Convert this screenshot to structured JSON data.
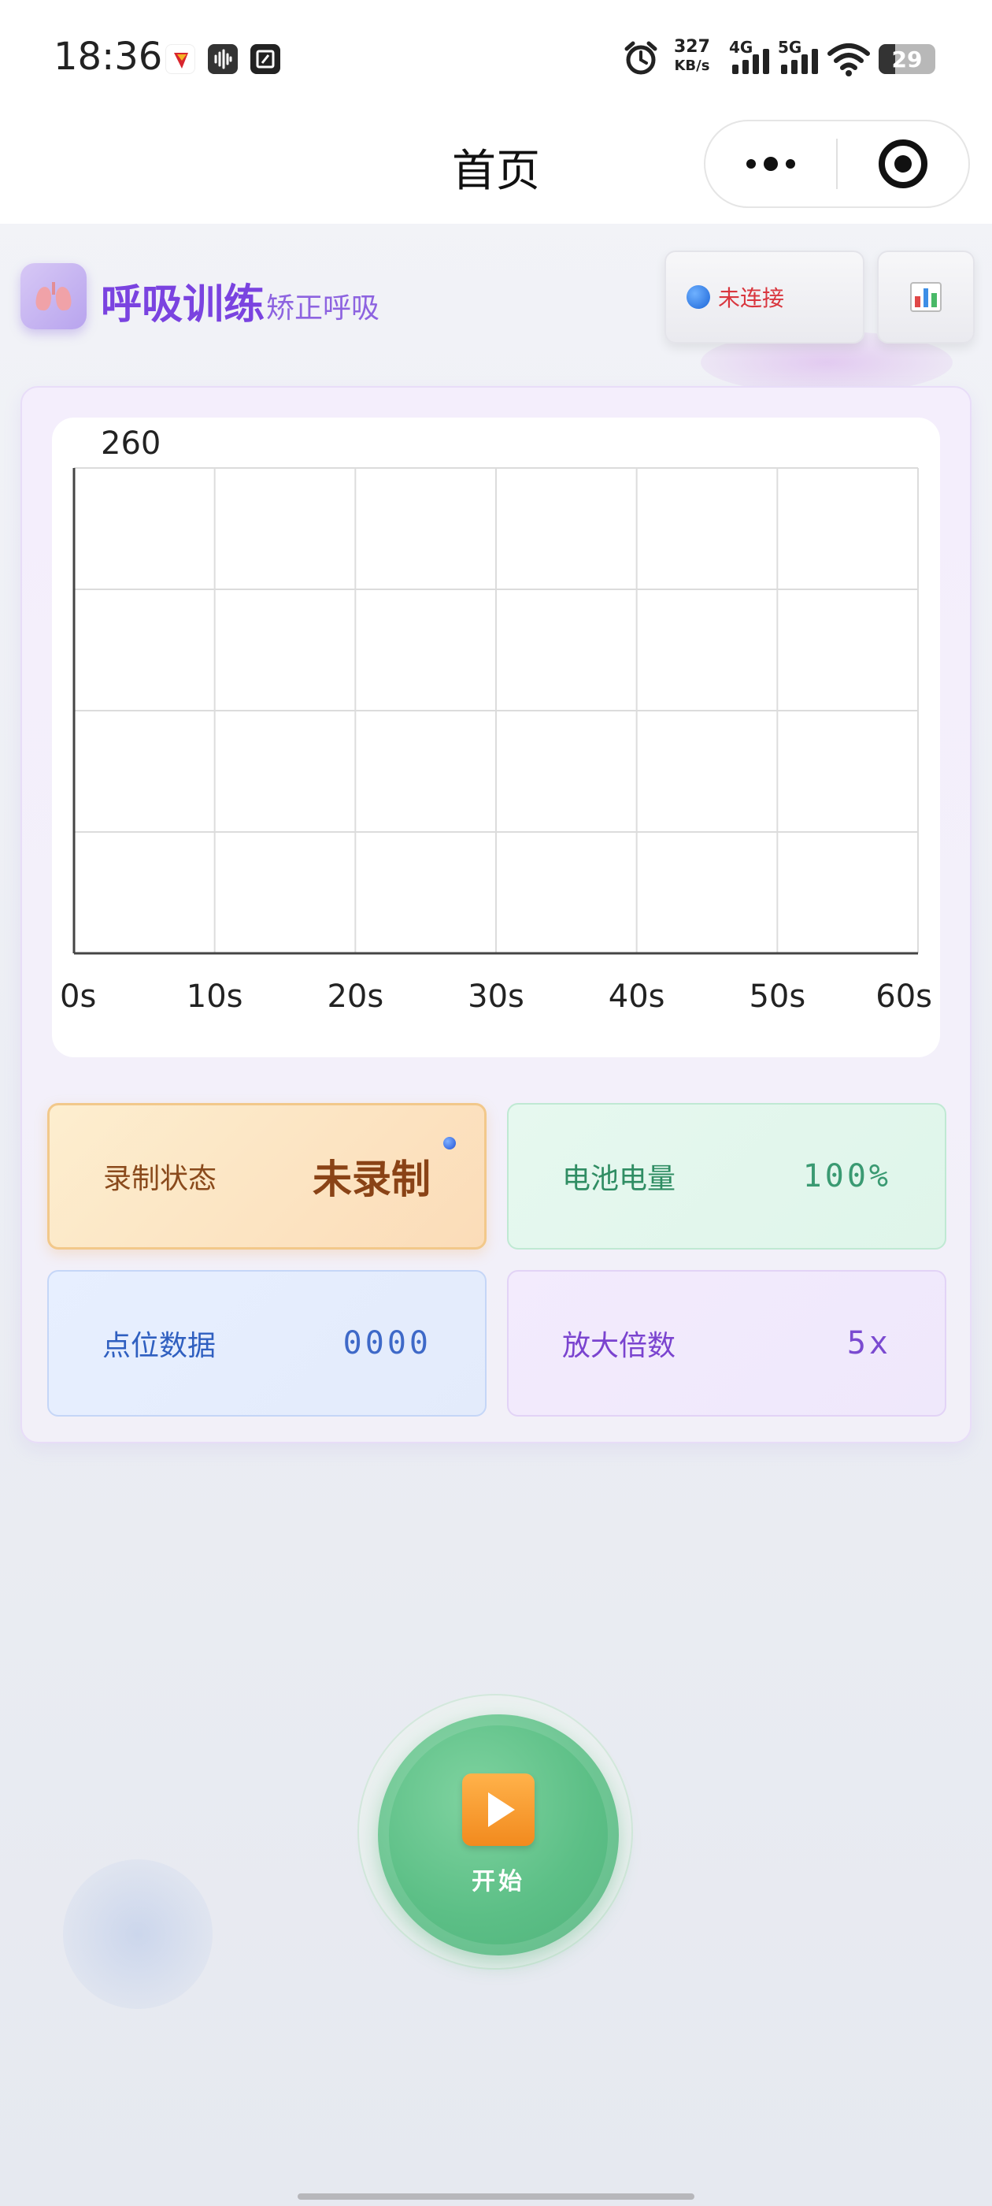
{
  "status_bar": {
    "time": "18:36",
    "net_speed_value": "327",
    "net_speed_unit": "KB/s",
    "signal_1_label": "4G",
    "signal_2_label": "5G",
    "battery_level": "29",
    "icons": [
      "shield-app-icon",
      "voice-app-icon",
      "note-app-icon",
      "alarm-icon",
      "signal-icon",
      "wifi-icon",
      "battery-icon"
    ]
  },
  "nav": {
    "title": "首页",
    "more_icon": "more-dots-icon",
    "close_icon": "target-close-icon"
  },
  "header": {
    "app_title": "呼吸训练",
    "app_subtitle": "矫正呼吸",
    "logo_icon": "lungs-icon",
    "connection_status": "未连接",
    "connection_icon": "blue-dot-icon",
    "chart_button_icon": "bar-chart-icon"
  },
  "chart_data": {
    "type": "line",
    "title": "",
    "xlabel": "",
    "ylabel": "",
    "y_max_label": "260",
    "x_tick_labels": [
      "0s",
      "10s",
      "20s",
      "30s",
      "40s",
      "50s",
      "60s"
    ],
    "xlim": [
      0,
      60
    ],
    "ylim": [
      0,
      260
    ],
    "grid": true,
    "series": []
  },
  "stats": {
    "recording": {
      "label": "录制状态",
      "value": "未录制"
    },
    "battery": {
      "label": "电池电量",
      "value": "100%"
    },
    "points": {
      "label": "点位数据",
      "value": "0000"
    },
    "zoom": {
      "label": "放大倍数",
      "value": "5x"
    }
  },
  "start_button": {
    "label": "开始",
    "icon": "play-icon"
  },
  "colors": {
    "accent_purple": "#7a43e0",
    "start_green": "#5cbf86",
    "disconnected_red": "#d9363e"
  }
}
